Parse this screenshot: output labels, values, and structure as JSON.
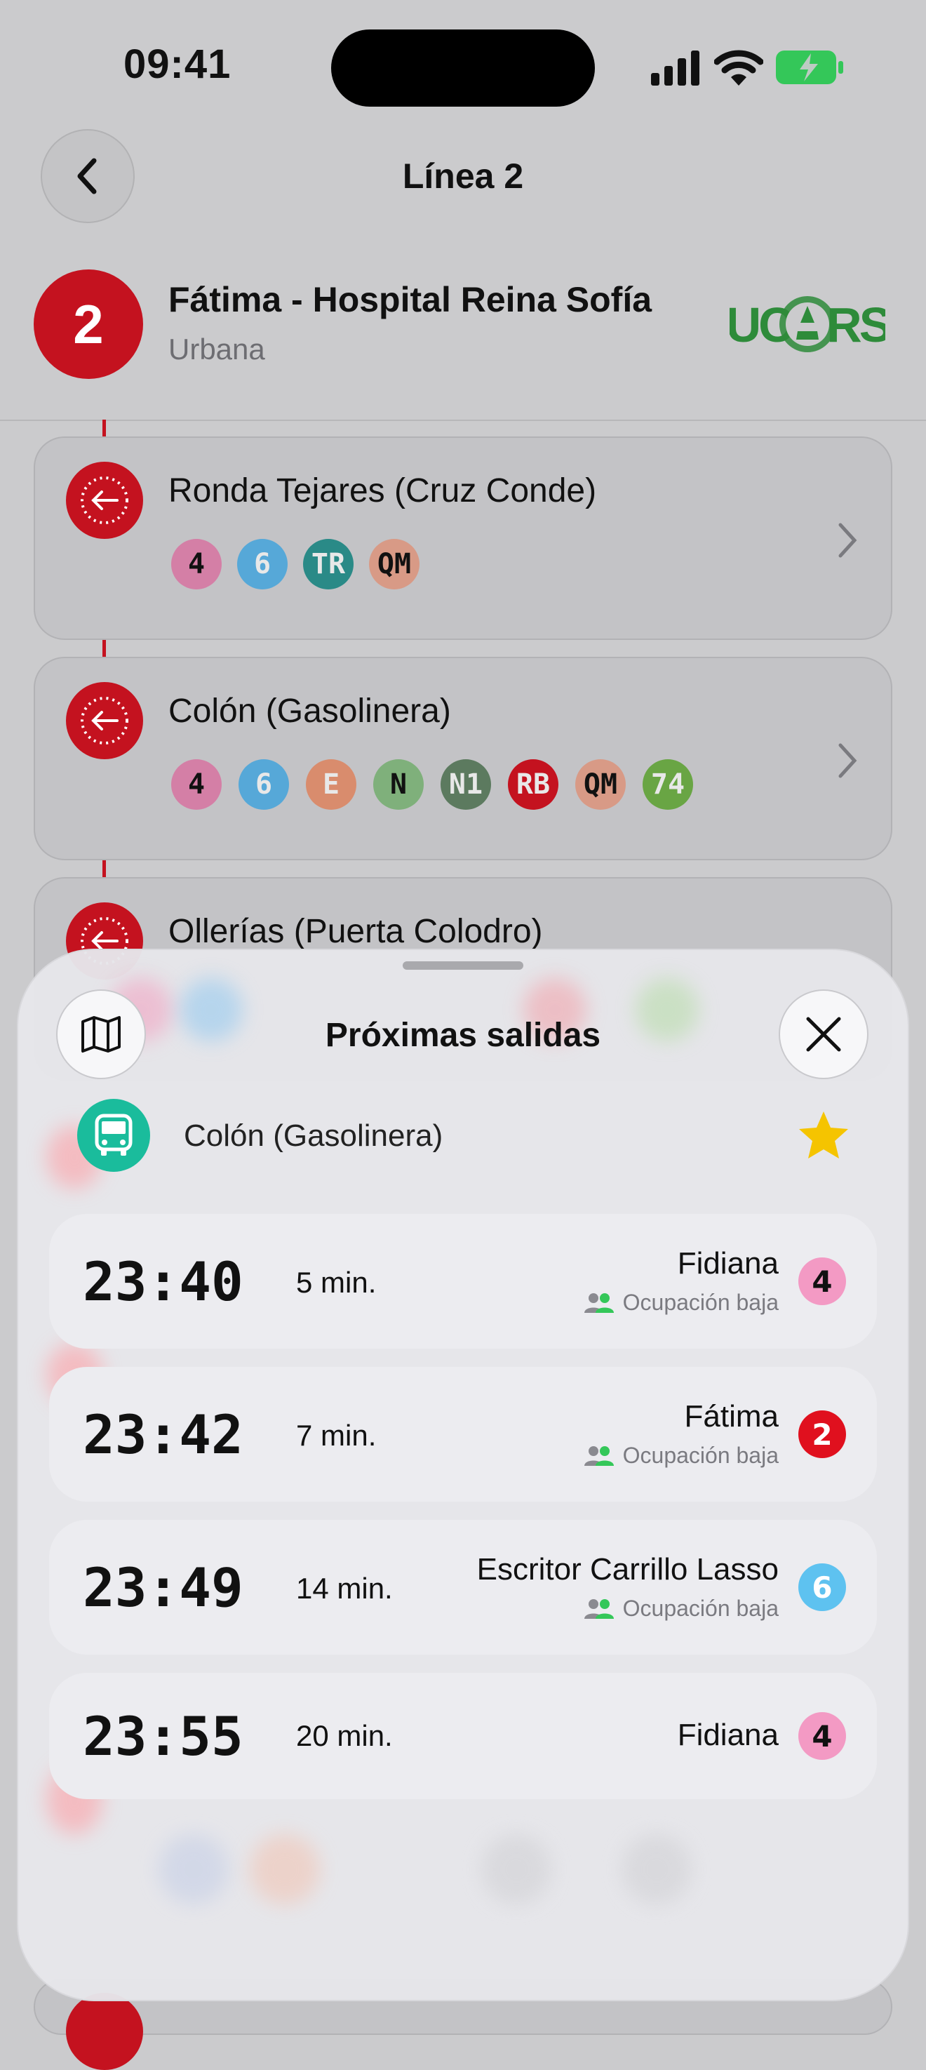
{
  "status": {
    "time": "09:41"
  },
  "header": {
    "title": "Línea 2"
  },
  "line": {
    "number": "2",
    "name": "Fátima - Hospital Reina Sofía",
    "type": "Urbana",
    "color": "#c4121f",
    "operator_logo": "AUCORSA"
  },
  "stops": [
    {
      "name": "Ronda Tejares (Cruz Conde)",
      "lines": [
        {
          "label": "4",
          "color": "#d47fa6"
        },
        {
          "label": "6",
          "color": "#56a8d8"
        },
        {
          "label": "TR",
          "color": "#2a8a87"
        },
        {
          "label": "QM",
          "color": "#d89a86"
        }
      ]
    },
    {
      "name": "Colón (Gasolinera)",
      "lines": [
        {
          "label": "4",
          "color": "#d47fa6"
        },
        {
          "label": "6",
          "color": "#56a8d8"
        },
        {
          "label": "E",
          "color": "#d98c6d"
        },
        {
          "label": "N",
          "color": "#7fb07b"
        },
        {
          "label": "N1",
          "color": "#5c7a5f"
        },
        {
          "label": "RB",
          "color": "#c4121f"
        },
        {
          "label": "QM",
          "color": "#d89a86"
        },
        {
          "label": "74",
          "color": "#69a544"
        }
      ]
    },
    {
      "name": "Ollerías (Puerta Colodro)",
      "lines": []
    }
  ],
  "sheet": {
    "title": "Próximas salidas",
    "stop_name": "Colón (Gasolinera)",
    "favorite": true,
    "departures": [
      {
        "time": "23:40",
        "minutes": "5 min.",
        "destination": "Fidiana",
        "occupancy": "Ocupación baja",
        "line": "4",
        "line_color": "#f39ac4",
        "text_color": "#111"
      },
      {
        "time": "23:42",
        "minutes": "7 min.",
        "destination": "Fátima",
        "occupancy": "Ocupación baja",
        "line": "2",
        "line_color": "#e0101e",
        "text_color": "#fff"
      },
      {
        "time": "23:49",
        "minutes": "14 min.",
        "destination": "Escritor Carrillo Lasso",
        "occupancy": "Ocupación baja",
        "line": "6",
        "line_color": "#5ec2f0",
        "text_color": "#fff"
      },
      {
        "time": "23:55",
        "minutes": "20 min.",
        "destination": "Fidiana",
        "occupancy": "",
        "line": "4",
        "line_color": "#f39ac4",
        "text_color": "#111"
      }
    ]
  },
  "icons": {
    "back": "chevron-left-icon",
    "map": "map-icon",
    "close": "close-icon",
    "bus": "bus-icon",
    "star": "star-icon",
    "stop": "stop-arrow-icon",
    "occupancy": "people-icon"
  }
}
